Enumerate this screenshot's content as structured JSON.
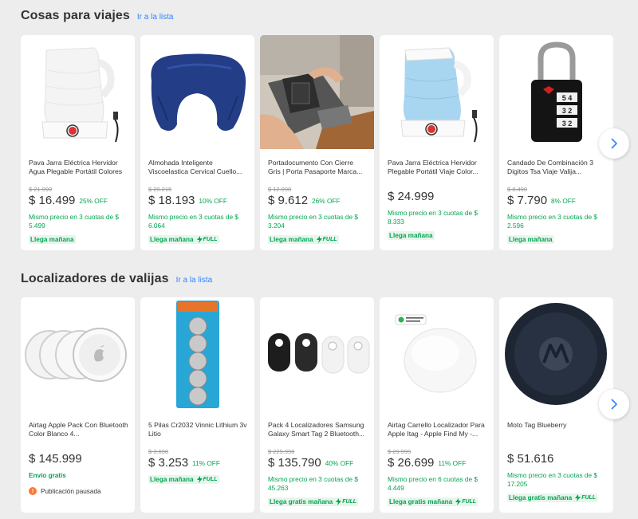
{
  "sections": [
    {
      "title": "Cosas para viajes",
      "link": "Ir a la lista",
      "cards": [
        {
          "title": "Pava Jarra Eléctrica Hervidor Agua Plegable Portátil Colores",
          "original_price": "$ 21.999",
          "price": "$ 16.499",
          "discount": "25% OFF",
          "installments": "Mismo precio en 3 cuotas de $ 5.499",
          "shipping": "Llega mañana",
          "full": false
        },
        {
          "title": "Almohada Inteligente Viscoelastica Cervical Cuello...",
          "original_price": "$ 20.215",
          "price": "$ 18.193",
          "discount": "10% OFF",
          "installments": "Mismo precio en 3 cuotas de $ 6.064",
          "shipping": "Llega mañana",
          "full": true
        },
        {
          "title": "Portadocumento Con Cierre Gris | Porta Pasaporte Marca...",
          "original_price": "$ 12.990",
          "price": "$ 9.612",
          "discount": "26% OFF",
          "installments": "Mismo precio en 3 cuotas de $ 3.204",
          "shipping": "Llega mañana",
          "full": true
        },
        {
          "title": "Pava Jarra Eléctrica Hervidor Plegable Portátil Viaje Color...",
          "original_price": "",
          "price": "$ 24.999",
          "discount": "",
          "installments": "Mismo precio en 3 cuotas de $ 8.333",
          "shipping": "Llega mañana",
          "full": false
        },
        {
          "title": "Candado De Combinación 3 Digitos Tsa Viaje Valija...",
          "original_price": "$ 8.490",
          "price": "$ 7.790",
          "discount": "8% OFF",
          "installments": "Mismo precio en 3 cuotas de $ 2.596",
          "shipping": "Llega mañana",
          "full": false
        }
      ]
    },
    {
      "title": "Localizadores de valijas",
      "link": "Ir a la lista",
      "cards": [
        {
          "title": "Airtag Apple Pack Con Bluetooth Color Blanco 4...",
          "original_price": "",
          "price": "$ 145.999",
          "discount": "",
          "free_shipping": "Envío gratis",
          "paused": "Publicación pausada"
        },
        {
          "title": "5 Pilas Cr2032 Vinnic Lithium 3v Litio",
          "original_price": "$ 3.690",
          "price": "$ 3.253",
          "discount": "11% OFF",
          "shipping": "Llega mañana",
          "full": true
        },
        {
          "title": "Pack 4 Localizadores Samsung Galaxy Smart Tag 2 Bluetooth...",
          "original_price": "$ 229.990",
          "price": "$ 135.790",
          "discount": "40% OFF",
          "installments": "Mismo precio en 3 cuotas de $ 45.263",
          "shipping": "Llega gratis mañana",
          "full": true
        },
        {
          "title": "Airtag Carrello Localizador Para Apple Itag - Apple Find My -...",
          "original_price": "$ 29.999",
          "price": "$ 26.699",
          "discount": "11% OFF",
          "installments": "Mismo precio en 6 cuotas de $ 4.449",
          "shipping": "Llega gratis mañana",
          "full": true
        },
        {
          "title": "Moto Tag Blueberry",
          "original_price": "",
          "price": "$ 51.616",
          "discount": "",
          "installments": "Mismo precio en 3 cuotas de $ 17.205",
          "shipping": "Llega gratis mañana",
          "full": true
        }
      ]
    }
  ],
  "full_label": "FULL",
  "icons": {
    "next": "chevron-right-icon",
    "full": "lightning-icon",
    "paused": "exclamation-icon"
  },
  "colors": {
    "accent_blue": "#3483fa",
    "green": "#00a650",
    "background": "#ededed"
  }
}
